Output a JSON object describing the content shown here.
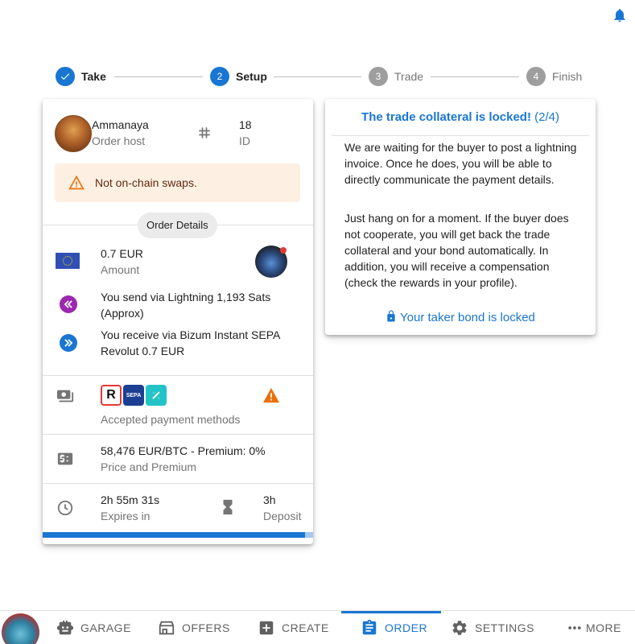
{
  "stepper": {
    "steps": [
      {
        "label": "Take",
        "number": "1",
        "state": "done"
      },
      {
        "label": "Setup",
        "number": "2",
        "state": "active"
      },
      {
        "label": "Trade",
        "number": "3",
        "state": "pending"
      },
      {
        "label": "Finish",
        "number": "4",
        "state": "pending"
      }
    ]
  },
  "order": {
    "host_name": "Ammanaya",
    "host_role": "Order host",
    "order_id": "18",
    "id_label": "ID",
    "warning": "Not on-chain swaps.",
    "details_chip": "Order Details",
    "amount_value": "0.7 EUR",
    "amount_label": "Amount",
    "send_text": "You send via Lightning 1,193 Sats (Approx)",
    "receive_text": "You receive via Bizum Instant SEPA Revolut 0.7 EUR",
    "payment_methods_label": "Accepted payment methods",
    "payment_logos": [
      "R",
      "SEPA",
      "Bizum"
    ],
    "price_value": "58,476 EUR/BTC - Premium: 0%",
    "price_label": "Price and Premium",
    "expires_value": "2h 55m 31s",
    "expires_label": "Expires in",
    "deposit_value": "3h",
    "deposit_label": "Deposit",
    "expiry_progress_fraction": 0.97
  },
  "info": {
    "title": "The trade collateral is locked!",
    "title_count": "(2/4)",
    "paragraph1": "We are waiting for the buyer to post a lightning invoice. Once he does, you will be able to directly communicate the payment details.",
    "paragraph2": "Just hang on for a moment. If the buyer does not cooperate, you will get back the trade collateral and your bond automatically. In addition, you will receive a compensation (check the rewards in your profile).",
    "bond_status": "Your taker bond is locked"
  },
  "nav": {
    "garage": "GARAGE",
    "offers": "OFFERS",
    "create": "CREATE",
    "order": "ORDER",
    "settings": "SETTINGS",
    "more": "MORE"
  },
  "colors": {
    "primary": "#1976d2",
    "warning_bg": "#fdf0e3",
    "warning_icon": "#e8710a",
    "send_icon": "#9c27b0",
    "receive_icon": "#1976d2"
  },
  "icons": [
    "bell-icon",
    "check-icon",
    "hash-icon",
    "warning-icon",
    "eu-flag-icon",
    "send-icon",
    "receive-icon",
    "payment-icon",
    "price-icon",
    "clock-icon",
    "hourglass-icon",
    "lock-icon",
    "garage-icon",
    "offers-icon",
    "create-icon",
    "order-icon",
    "settings-icon",
    "more-icon"
  ]
}
